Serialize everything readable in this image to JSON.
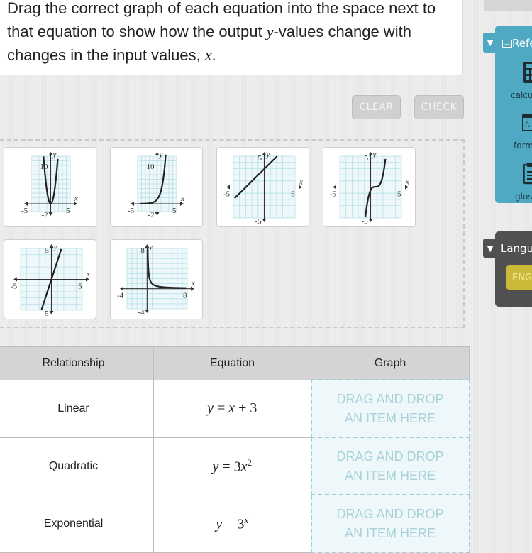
{
  "prompt": {
    "part1": "Drag the correct graph of each equation into the space next to that equation to show how the output ",
    "var_y": "y",
    "part2": "-values change with changes in the input values, ",
    "var_x": "x",
    "part3": "."
  },
  "toolbar": {
    "clear_label": "CLEAR",
    "check_label": "CHECK"
  },
  "graph_tiles": [
    {
      "name": "tile-quadratic-graph",
      "x_axis": "x",
      "y_axis": "y",
      "xmin_label": "-5",
      "xmax_label": "5",
      "ymin_label": "-2",
      "ymax_label": "10",
      "curve": "parabola"
    },
    {
      "name": "tile-exponential-graph",
      "x_axis": "x",
      "y_axis": "y",
      "xmin_label": "-5",
      "xmax_label": "5",
      "ymin_label": "-2",
      "ymax_label": "10",
      "curve": "exponential"
    },
    {
      "name": "tile-linear-graph",
      "x_axis": "x",
      "y_axis": "y",
      "xmin_label": "-5",
      "xmax_label": "5",
      "ymin_label": "-5",
      "ymax_label": "5",
      "curve": "line-slope-1"
    },
    {
      "name": "tile-cubic-graph",
      "x_axis": "x",
      "y_axis": "y",
      "xmin_label": "-5",
      "xmax_label": "5",
      "ymin_label": "-5",
      "ymax_label": "5",
      "curve": "cubic"
    },
    {
      "name": "tile-steep-linear-graph",
      "x_axis": "x",
      "y_axis": "y",
      "xmin_label": "-5",
      "xmax_label": "5",
      "ymin_label": "-5",
      "ymax_label": "5",
      "curve": "line-steep"
    },
    {
      "name": "tile-reciprocal-graph",
      "x_axis": "x",
      "y_axis": "y",
      "xmin_label": "-4",
      "xmax_label": "8",
      "ymin_label": "-4",
      "ymax_label": "8",
      "curve": "reciprocal"
    }
  ],
  "table": {
    "headers": [
      "Relationship",
      "Equation",
      "Graph"
    ],
    "rows": [
      {
        "relationship": "Linear",
        "eq_lhs": "y",
        "eq_mid": " = ",
        "eq_rhs": "x",
        "eq_tail": " + 3",
        "eq_sup": "",
        "drop_line1": "DRAG AND DROP",
        "drop_line2": "AN ITEM HERE"
      },
      {
        "relationship": "Quadratic",
        "eq_lhs": "y",
        "eq_mid": " = 3",
        "eq_rhs": "x",
        "eq_tail": "",
        "eq_sup": "2",
        "drop_line1": "DRAG AND DROP",
        "drop_line2": "AN ITEM HERE"
      },
      {
        "relationship": "Exponential",
        "eq_lhs": "y",
        "eq_mid": " = 3",
        "eq_rhs": "",
        "eq_tail": "",
        "eq_sup": "x",
        "drop_line1": "DRAG AND DROP",
        "drop_line2": "AN ITEM HERE"
      }
    ]
  },
  "reference_panel": {
    "title": "Refe",
    "items": [
      "calcu",
      "form",
      "glos"
    ]
  },
  "language_panel": {
    "title": "Langu",
    "button": "ENG"
  },
  "colors": {
    "reference": "#4fa9c2",
    "language": "#505050",
    "language_button": "#cbb93a",
    "grid": "#b6dfe8"
  }
}
